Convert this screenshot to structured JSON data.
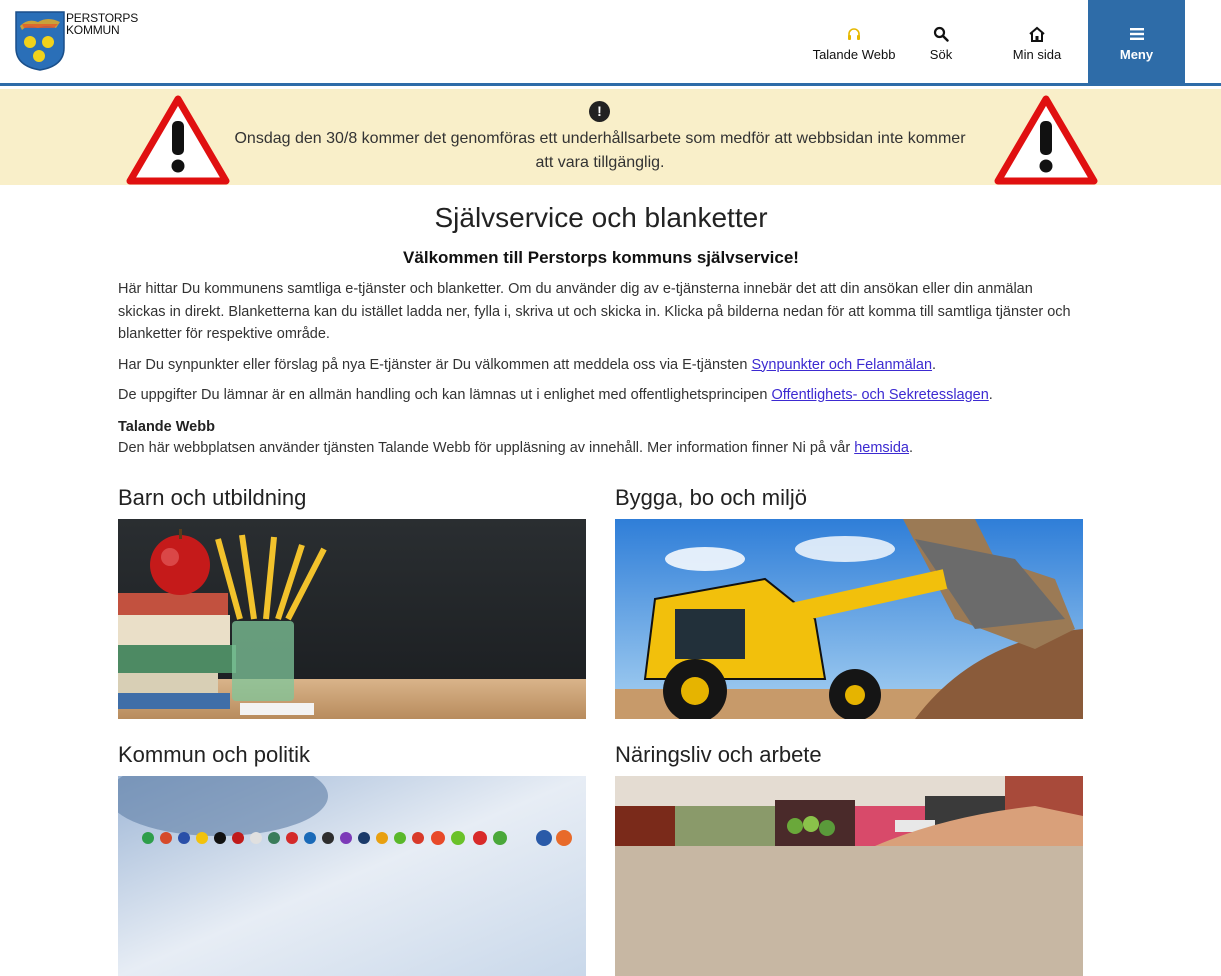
{
  "header": {
    "logo_line1": "PERSTORPS",
    "logo_line2": "KOMMUN",
    "nav": {
      "talande": "Talande Webb",
      "sok": "Sök",
      "minsida": "Min sida",
      "meny": "Meny"
    }
  },
  "alert": {
    "icon": "exclamation-icon",
    "text": "Onsdag den 30/8 kommer det genomföras ett underhållsarbete som medför att webbsidan inte kommer att vara tillgänglig."
  },
  "main": {
    "title": "Självservice och blanketter",
    "welcome": "Välkommen till Perstorps kommuns självservice!",
    "intro": "Här hittar Du kommunens samtliga e-tjänster och blanketter. Om du använder dig av e-tjänsterna innebär det att din ansökan eller din anmälan skickas in direkt. Blanketterna kan du istället ladda ner, fylla i, skriva ut och skicka in. Klicka på bilderna nedan för att komma till samtliga tjänster och blanketter för respektive område.",
    "feedback_prefix": "Har Du synpunkter eller förslag på nya E-tjänster är Du välkommen att meddela oss via E-tjänsten ",
    "feedback_link": "Synpunkter och Felanmälan",
    "feedback_suffix": ".",
    "public_prefix": "De uppgifter Du lämnar är en allmän handling och kan lämnas ut i enlighet med offentlighetsprincipen ",
    "public_link": "Offentlighets- och Sekretesslagen",
    "public_suffix": ".",
    "talande_heading": "Talande Webb",
    "talande_prefix": "Den här webbplatsen använder tjänsten Talande Webb för uppläsning av innehåll. Mer information finner Ni på vår ",
    "talande_link": "hemsida",
    "talande_suffix": "."
  },
  "categories": [
    {
      "title": "Barn och utbildning"
    },
    {
      "title": "Bygga, bo och miljö"
    },
    {
      "title": "Kommun och politik"
    },
    {
      "title": "Näringsliv och arbete"
    }
  ],
  "colors": {
    "primary": "#2e6ca8",
    "alert_bg": "#f9efc9",
    "link": "#3c2ad1"
  }
}
